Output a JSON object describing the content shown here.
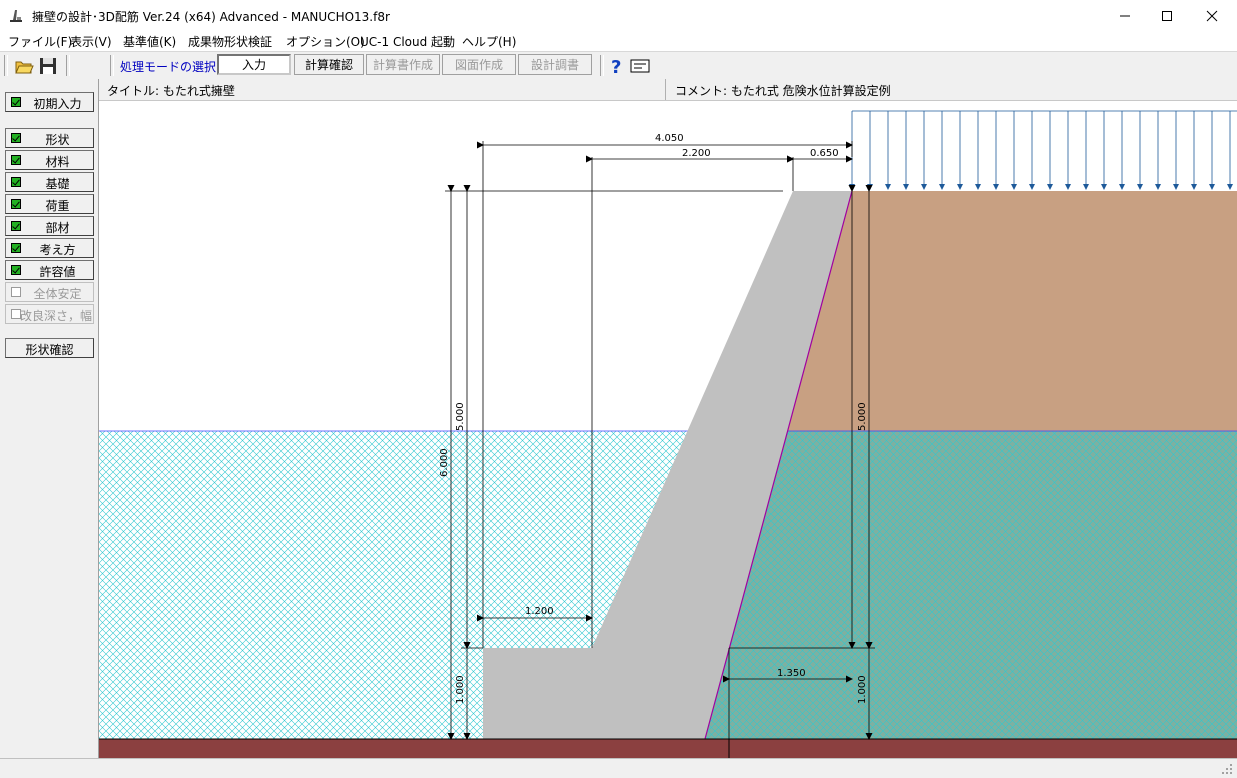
{
  "window": {
    "title": "擁壁の設計･3D配筋 Ver.24 (x64) Advanced  - MANUCHO13.f8r"
  },
  "menu": [
    "ファイル(F)",
    "表示(V)",
    "基準値(K)",
    "成果物形状検証",
    "オプション(O)",
    "UC-1 Cloud 起動",
    "ヘルプ(H)"
  ],
  "toolbar": {
    "mode_label": "処理モードの選択",
    "modes": [
      {
        "label": "入力",
        "state": "active"
      },
      {
        "label": "計算確認",
        "state": "enabled"
      },
      {
        "label": "計算書作成",
        "state": "disabled"
      },
      {
        "label": "図面作成",
        "state": "disabled"
      },
      {
        "label": "設計調書",
        "state": "disabled"
      }
    ]
  },
  "sidebar": {
    "initial_input": "初期入力",
    "items": [
      {
        "label": "形状",
        "checked": true
      },
      {
        "label": "材料",
        "checked": true
      },
      {
        "label": "基礎",
        "checked": true
      },
      {
        "label": "荷重",
        "checked": true
      },
      {
        "label": "部材",
        "checked": true
      },
      {
        "label": "考え方",
        "checked": true
      },
      {
        "label": "許容値",
        "checked": true
      },
      {
        "label": "全体安定",
        "checked": false
      },
      {
        "label": "改良深さ，幅",
        "checked": false
      }
    ],
    "shape_check": "形状確認"
  },
  "header": {
    "title": "タイトル: もたれ式擁壁",
    "comment": "コメント: もたれ式 危険水位計算設定例"
  },
  "drawing": {
    "dims": {
      "top_total": "4.050",
      "top_mid": "2.200",
      "top_right": "0.650",
      "height_total": "6.000",
      "height_wall": "5.000",
      "height_base": "1.000",
      "toe_width": "1.200",
      "heel_width": "1.350",
      "right_height_upper": "5.000",
      "right_height_lower": "1.000"
    },
    "colors": {
      "soil": "#c8a082",
      "concrete": "#c0c0c0",
      "water_hatch": "#30c8d0",
      "base_ground": "#8b4040",
      "load_arrow": "#1e5a9a",
      "backfill_line": "#a000a0"
    }
  }
}
